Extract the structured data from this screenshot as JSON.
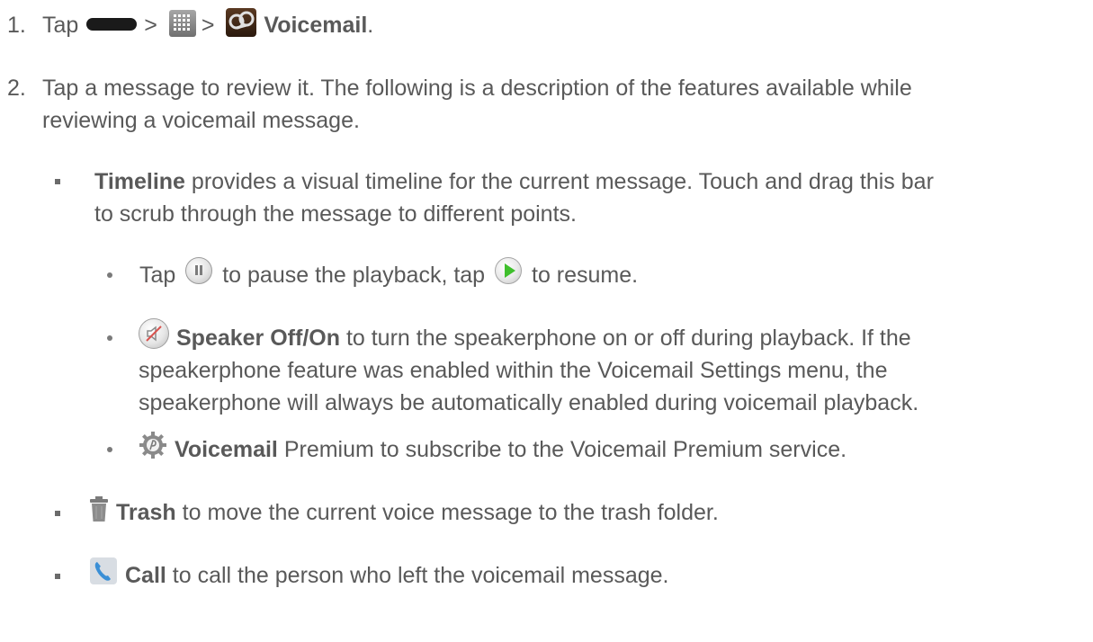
{
  "step1": {
    "number": "1.",
    "tap": "Tap",
    "sep1": ">",
    "sep2": ">",
    "voicemail": "Voicemail",
    "period": "."
  },
  "step2": {
    "number": "2.",
    "line1": "Tap a message to review it. The following is a description of the features available while",
    "line2": "reviewing a voicemail message."
  },
  "timeline": {
    "title": "Timeline",
    "line1_rest": " provides a visual timeline for the current message. Touch and drag this bar",
    "line2": "to scrub through the message to different points."
  },
  "pause_play": {
    "tap1": "Tap",
    "mid": "to pause the playback, tap",
    "end": "to resume."
  },
  "speaker": {
    "title": "Speaker Off/On",
    "line1_rest": " to turn the speakerphone on or off during playback. If the",
    "line2": "speakerphone feature was enabled within the Voicemail Settings menu, the",
    "line3": "speakerphone will always be automatically enabled during voicemail playback."
  },
  "premium": {
    "title": "Voicemail",
    "rest": " Premium to subscribe to the Voicemail Premium service."
  },
  "trash": {
    "title": "Trash",
    "rest": " to move the current voice message to the trash folder."
  },
  "call": {
    "title": "Call",
    "rest": " to call the person who left the voicemail message."
  },
  "icons": {
    "home": "home-key-icon",
    "apps": "apps-grid-icon",
    "voicemail": "voicemail-app-icon",
    "pause": "pause-icon",
    "play": "play-icon",
    "speaker": "speaker-off-icon",
    "premium": "voicemail-premium-icon",
    "trash": "trash-icon",
    "call": "call-icon"
  },
  "colors": {
    "text": "#595959",
    "play_green": "#3fbf2c",
    "call_blue": "#3a8fd6"
  }
}
